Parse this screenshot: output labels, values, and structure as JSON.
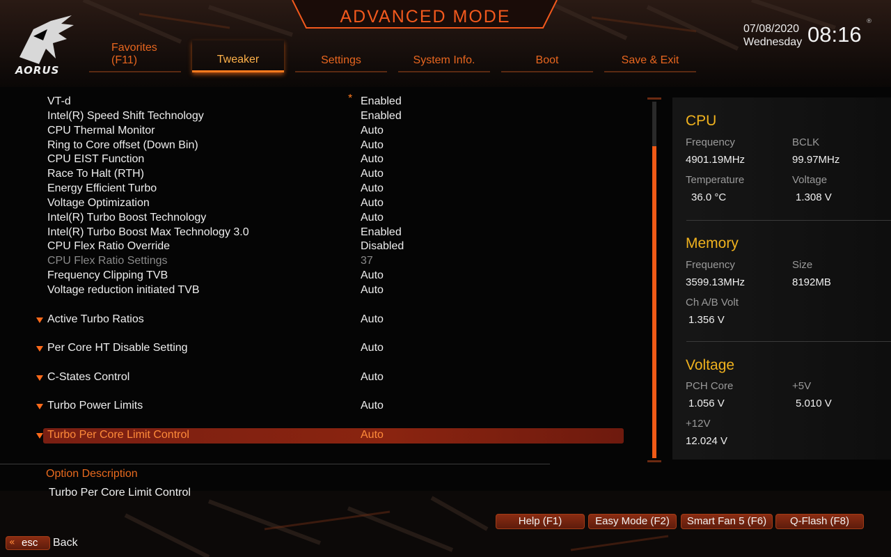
{
  "brand": {
    "logo_text": "AORUS"
  },
  "header": {
    "mode_title": "ADVANCED MODE",
    "date": "07/08/2020",
    "weekday": "Wednesday",
    "time": "08:16",
    "registered_mark": "®"
  },
  "tabs": [
    {
      "label_line1": "Favorites",
      "label_line2": "(F11)",
      "active": false
    },
    {
      "label": "Tweaker",
      "active": true
    },
    {
      "label": "Settings",
      "active": false
    },
    {
      "label": "System Info.",
      "active": false
    },
    {
      "label": "Boot",
      "active": false
    },
    {
      "label": "Save & Exit",
      "active": false
    }
  ],
  "settings": {
    "rows": [
      {
        "name": "VT-d",
        "value": "Enabled",
        "modified": true
      },
      {
        "name": "Intel(R) Speed Shift Technology",
        "value": "Enabled"
      },
      {
        "name": "CPU Thermal Monitor",
        "value": "Auto"
      },
      {
        "name": "Ring to Core offset (Down Bin)",
        "value": "Auto"
      },
      {
        "name": "CPU EIST Function",
        "value": "Auto"
      },
      {
        "name": "Race To Halt (RTH)",
        "value": "Auto"
      },
      {
        "name": "Energy Efficient Turbo",
        "value": "Auto"
      },
      {
        "name": "Voltage Optimization",
        "value": "Auto"
      },
      {
        "name": "Intel(R) Turbo Boost Technology",
        "value": "Auto"
      },
      {
        "name": "Intel(R) Turbo Boost Max Technology 3.0",
        "value": "Enabled"
      },
      {
        "name": "CPU Flex Ratio Override",
        "value": "Disabled"
      },
      {
        "name": "CPU Flex Ratio Settings",
        "value": "37",
        "disabled": true
      },
      {
        "name": "Frequency Clipping TVB",
        "value": "Auto"
      },
      {
        "name": "Voltage reduction initiated TVB",
        "value": "Auto"
      },
      {
        "name": "Active Turbo Ratios",
        "value": "Auto",
        "submenu": true
      },
      {
        "name": "Per Core HT Disable Setting",
        "value": "Auto",
        "submenu": true
      },
      {
        "name": "C-States Control",
        "value": "Auto",
        "submenu": true
      },
      {
        "name": "Turbo Power Limits",
        "value": "Auto",
        "submenu": true
      },
      {
        "name": "Turbo Per Core Limit Control",
        "value": "Auto",
        "submenu": true,
        "selected": true
      }
    ],
    "modified_mark": "*"
  },
  "hw_monitor": {
    "cpu": {
      "title": "CPU",
      "frequency_label": "Frequency",
      "frequency_value": "4901.19MHz",
      "bclk_label": "BCLK",
      "bclk_value": "99.97MHz",
      "temperature_label": "Temperature",
      "temperature_value": "36.0 °C",
      "voltage_label": "Voltage",
      "voltage_value": "1.308 V"
    },
    "memory": {
      "title": "Memory",
      "frequency_label": "Frequency",
      "frequency_value": "3599.13MHz",
      "size_label": "Size",
      "size_value": "8192MB",
      "chab_label": "Ch A/B Volt",
      "chab_value": "1.356 V"
    },
    "voltage": {
      "title": "Voltage",
      "pch_label": "PCH Core",
      "pch_value": "1.056 V",
      "v5_label": "+5V",
      "v5_value": "5.010 V",
      "v12_label": "+12V",
      "v12_value": "12.024 V"
    }
  },
  "description": {
    "title": "Option Description",
    "text": "Turbo Per Core Limit Control"
  },
  "footer": {
    "buttons": [
      {
        "label": "Help (F1)"
      },
      {
        "label": "Easy Mode (F2)"
      },
      {
        "label": "Smart Fan 5 (F6)"
      },
      {
        "label": "Q-Flash (F8)"
      }
    ],
    "esc_label": "esc",
    "esc_chevron": "«",
    "back_label": "Back"
  },
  "colors": {
    "accent": "#f2591d",
    "section_title": "#f0b21e",
    "selected_row": "#8a2410",
    "scroll_thumb": "#f05a16"
  }
}
